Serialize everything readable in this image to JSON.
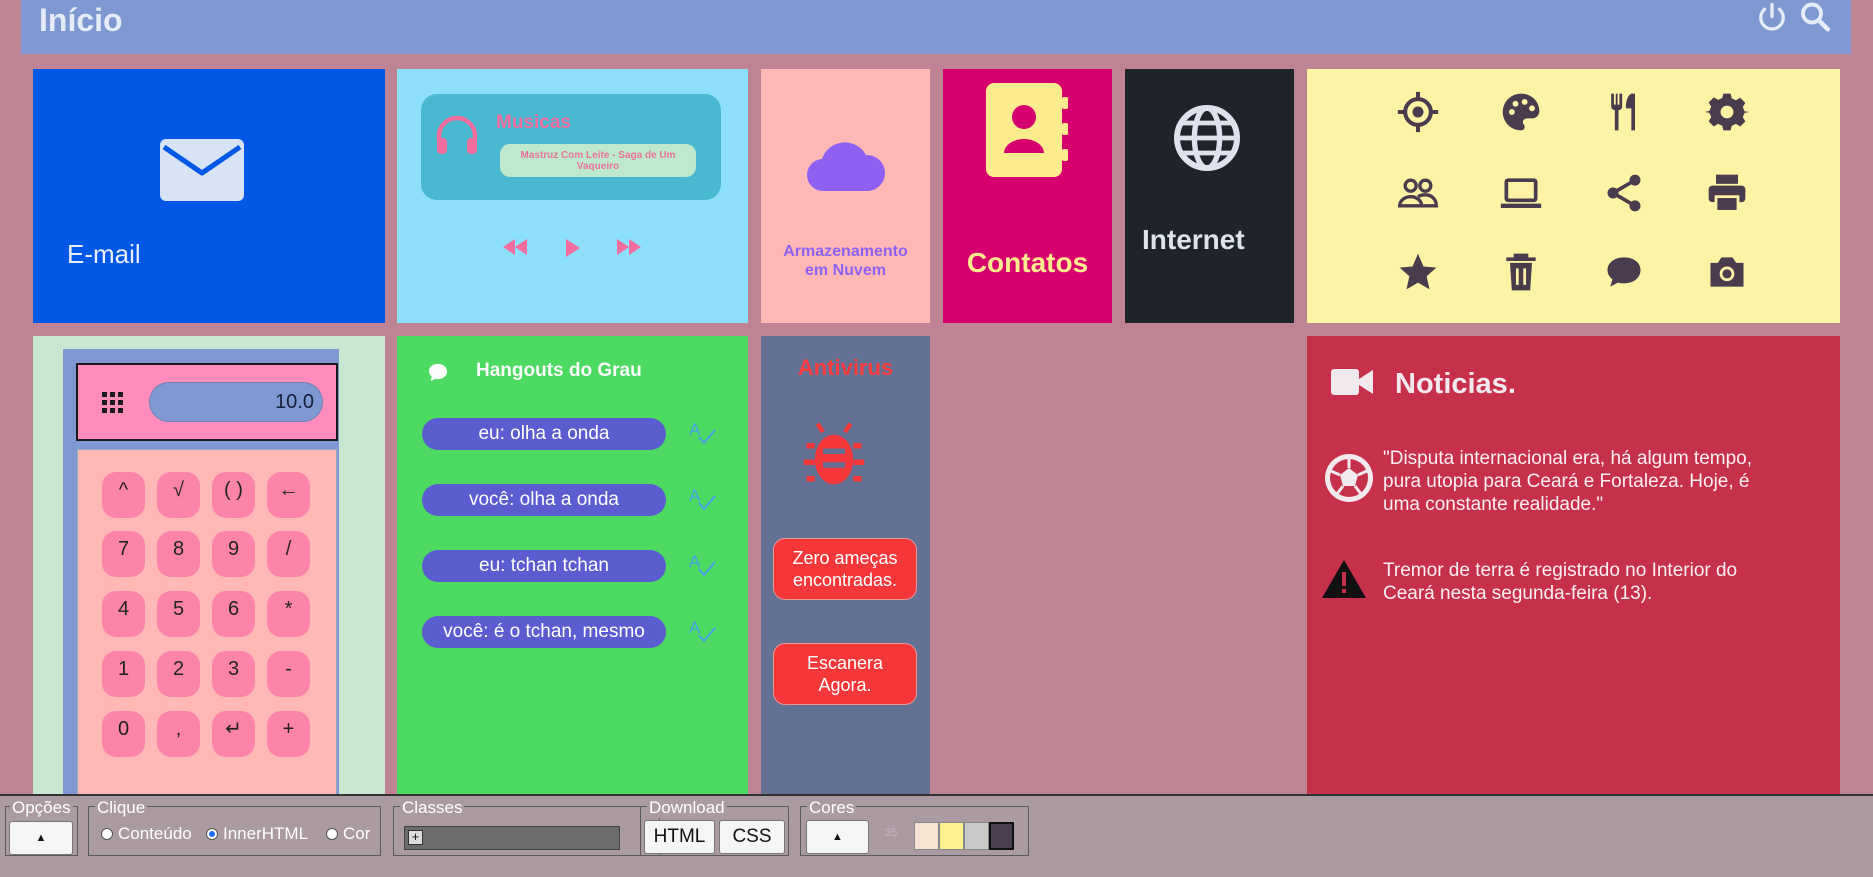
{
  "header": {
    "title": "Início"
  },
  "tiles": {
    "email": {
      "label": "E-mail"
    },
    "music": {
      "title": "Musicas",
      "song": "Mastruz Com Leite - Saga de Um Vaqueiro"
    },
    "cloud": {
      "label_line1": "Armazenamento",
      "label_line2": "em Nuvem"
    },
    "contacts": {
      "label": "Contatos"
    },
    "internet": {
      "label": "Internet"
    },
    "icon_grid": [
      "crosshair-icon",
      "palette-icon",
      "restaurant-icon",
      "gear-icon",
      "people-icon",
      "laptop-icon",
      "share-icon",
      "printer-icon",
      "star-icon",
      "trash-icon",
      "chat-icon",
      "camera-icon"
    ],
    "calculator": {
      "display": "10.0",
      "keys": [
        "^",
        "√",
        "( )",
        "←",
        "7",
        "8",
        "9",
        "/",
        "4",
        "5",
        "6",
        "*",
        "1",
        "2",
        "3",
        "-",
        "0",
        ",",
        "↵",
        "+"
      ]
    },
    "hangouts": {
      "title": "Hangouts do Grau",
      "messages": [
        "eu: olha a onda",
        "você: olha a onda",
        "eu: tchan tchan",
        "você: é o tchan, mesmo"
      ]
    },
    "antivirus": {
      "title": "Antivirus",
      "status_line1": "Zero ameças",
      "status_line2": "encontradas.",
      "scan_line1": "Escanera",
      "scan_line2": "Agora."
    },
    "news": {
      "title": "Noticias.",
      "items": [
        {
          "icon": "soccer-ball-icon",
          "line1": "\"Disputa internacional era, há algum tempo,",
          "line2": "pura utopia para Ceará e Fortaleza. Hoje, é",
          "line3": "uma constante realidade.\""
        },
        {
          "icon": "warning-icon",
          "line1": "Tremor de terra é registrado no Interior do",
          "line2": "Ceará nesta segunda-feira (13)."
        }
      ]
    }
  },
  "bottombar": {
    "opcoes": {
      "legend": "Opções",
      "button": "▲"
    },
    "clique": {
      "legend": "Clique",
      "options": [
        "Conteúdo",
        "InnerHTML",
        "Cor"
      ],
      "selected": "InnerHTML"
    },
    "classes": {
      "legend": "Classes",
      "add": "+"
    },
    "download": {
      "legend": "Download",
      "html": "HTML",
      "css": "CSS"
    },
    "cores": {
      "legend": "Cores",
      "button": "▲",
      "value": "35",
      "swatches": [
        "#f6e3d2",
        "#fdf08e",
        "#c9c9c9",
        "#4b3f52"
      ]
    }
  },
  "colors": {
    "header": "#7f98d2",
    "email": "#0157e6",
    "music": "#8ee0fa",
    "cloud": "#ffb8b6",
    "contacts": "#d6006f",
    "internet": "#1e242a",
    "icons": "#fdf3a5",
    "hangouts": "#4cda62",
    "antivirus": "#637195",
    "news": "#c7304a"
  }
}
